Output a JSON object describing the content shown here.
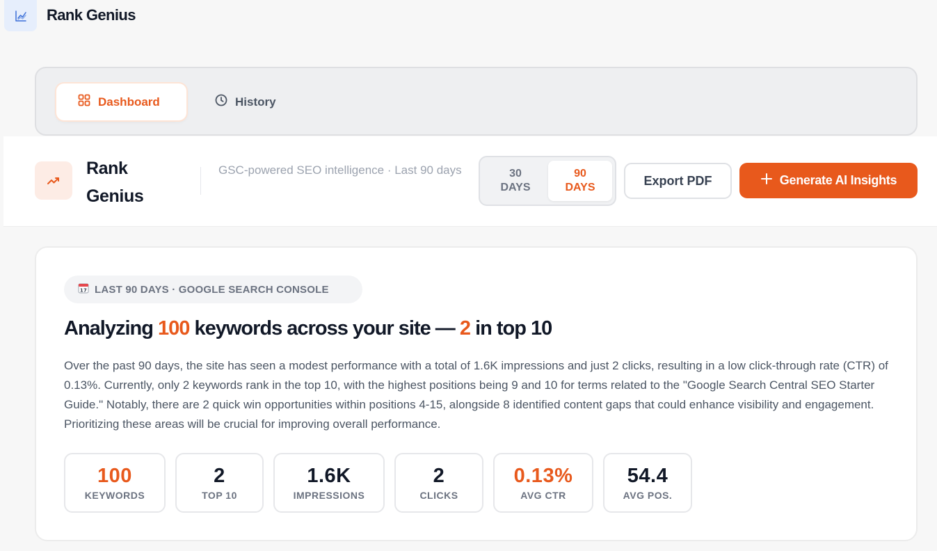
{
  "app": {
    "brand_name": "Rank Genius",
    "brand_icon": "chart-line-icon"
  },
  "tabs": [
    {
      "label": "Dashboard",
      "icon": "grid-icon",
      "active": true
    },
    {
      "label": "History",
      "icon": "clock-icon",
      "active": false
    }
  ],
  "header": {
    "title_line1": "Rank",
    "title_line2": "Genius",
    "icon": "trending-up-icon",
    "subtitle": "GSC-powered SEO intelligence · Last 90 days",
    "range": {
      "options": [
        {
          "line1": "30",
          "line2": "DAYS",
          "selected": false
        },
        {
          "line1": "90",
          "line2": "DAYS",
          "selected": true
        }
      ]
    },
    "export_label": "Export PDF",
    "generate_label": "Generate AI Insights"
  },
  "summary": {
    "pill_icon": "calendar-icon",
    "pill_text": "LAST 90 DAYS · GOOGLE SEARCH CONSOLE",
    "headline_prefix": "Analyzing ",
    "headline_keywords": "100",
    "headline_middle": " keywords across your site — ",
    "headline_top": "2",
    "headline_suffix": " in top 10",
    "body": "Over the past 90 days, the site has seen a modest performance with a total of 1.6K impressions and just 2 clicks, resulting in a low click-through rate (CTR) of 0.13%. Currently, only 2 keywords rank in the top 10, with the highest positions being 9 and 10 for terms related to the \"Google Search Central SEO Starter Guide.\" Notably, there are 2 quick win opportunities within positions 4-15, alongside 8 identified content gaps that could enhance visibility and engagement. Prioritizing these areas will be crucial for improving overall performance.",
    "stats": [
      {
        "value": "100",
        "label": "KEYWORDS"
      },
      {
        "value": "2",
        "label": "TOP 10"
      },
      {
        "value": "1.6K",
        "label": "IMPRESSIONS"
      },
      {
        "value": "2",
        "label": "CLICKS"
      },
      {
        "value": "0.13%",
        "label": "AVG CTR"
      },
      {
        "value": "54.4",
        "label": "AVG POS."
      }
    ]
  },
  "colors": {
    "accent": "#e8591c",
    "text": "#111827",
    "muted": "#6b7280"
  }
}
